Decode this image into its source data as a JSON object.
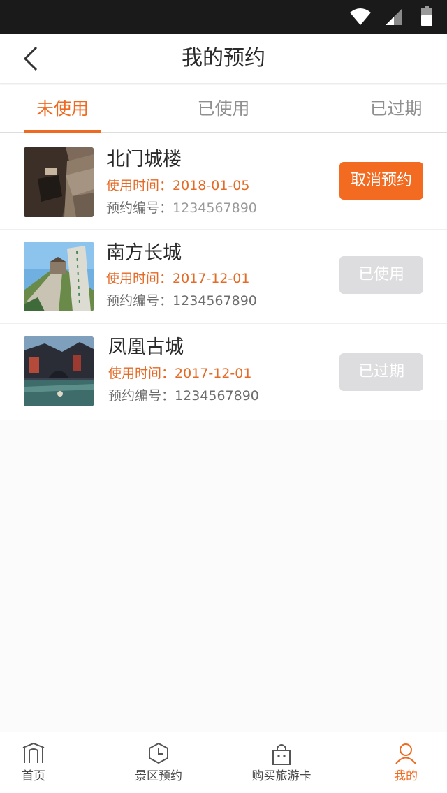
{
  "header": {
    "title": "我的预约"
  },
  "tabs": [
    {
      "label": "未使用"
    },
    {
      "label": "已使用"
    },
    {
      "label": "已过期"
    }
  ],
  "reservations": [
    {
      "name": "北门城楼",
      "time_label": "使用时间：",
      "time": "2018-01-05",
      "code_label": "预约编号：",
      "code": "1234567890",
      "action": "取消预约"
    },
    {
      "name": "南方长城",
      "time_label": "使用时间：",
      "time": "2017-12-01",
      "code_label": "预约编号：",
      "code": "1234567890",
      "action": "已使用"
    },
    {
      "name": "凤凰古城",
      "time_label": "使用时间：",
      "time": "2017-12-01",
      "code_label": "预约编号：",
      "code": "1234567890",
      "action": "已过期"
    }
  ],
  "bottom_nav": [
    {
      "label": "首页",
      "icon": "gate-icon"
    },
    {
      "label": "景区预约",
      "icon": "clock-icon"
    },
    {
      "label": "购买旅游卡",
      "icon": "bag-icon"
    },
    {
      "label": "我的",
      "icon": "user-icon"
    }
  ],
  "colors": {
    "accent": "#ef6a21",
    "disabled": "#dddddf"
  }
}
